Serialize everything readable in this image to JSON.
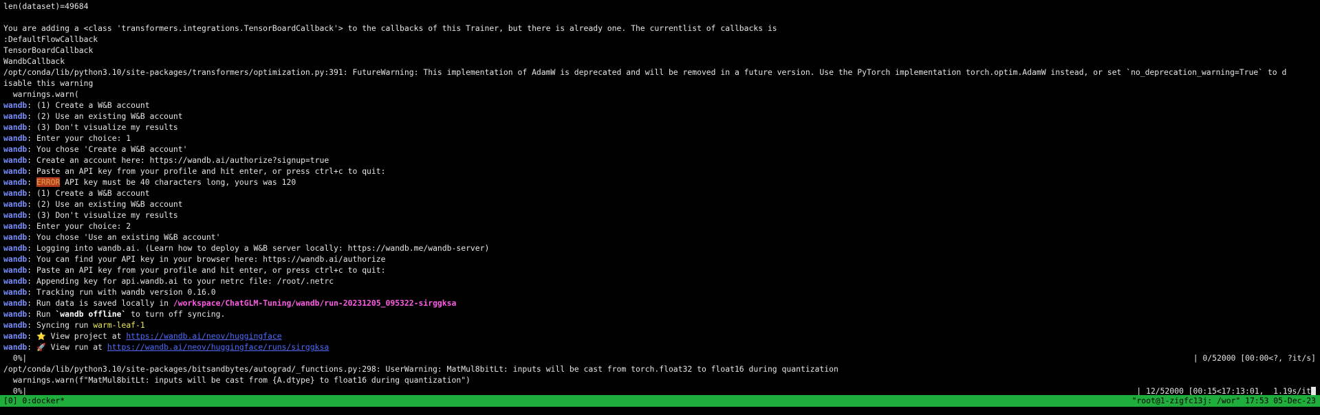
{
  "lines": {
    "l01": "len(dataset)=49684",
    "l02": "",
    "l03": "You are adding a <class 'transformers.integrations.TensorBoardCallback'> to the callbacks of this Trainer, but there is already one. The currentlist of callbacks is",
    "l04": ":DefaultFlowCallback",
    "l05": "TensorBoardCallback",
    "l06": "WandbCallback",
    "l07": "/opt/conda/lib/python3.10/site-packages/transformers/optimization.py:391: FutureWarning: This implementation of AdamW is deprecated and will be removed in a future version. Use the PyTorch implementation torch.optim.AdamW instead, or set `no_deprecation_warning=True` to d",
    "l08": "isable this warning",
    "l09": "  warnings.warn(",
    "w_prefix": "wandb",
    "w01": ": (1) Create a W&B account",
    "w02": ": (2) Use an existing W&B account",
    "w03": ": (3) Don't visualize my results",
    "w04": ": Enter your choice: 1",
    "w05": ": You chose 'Create a W&B account'",
    "w06": ": Create an account here: https://wandb.ai/authorize?signup=true",
    "w07": ": Paste an API key from your profile and hit enter, or press ctrl+c to quit:",
    "w08_sep": ": ",
    "w08_error": "ERROR",
    "w08_rest": " API key must be 40 characters long, yours was 120",
    "w09": ": (1) Create a W&B account",
    "w10": ": (2) Use an existing W&B account",
    "w11": ": (3) Don't visualize my results",
    "w12": ": Enter your choice: 2",
    "w13": ": You chose 'Use an existing W&B account'",
    "w14": ": Logging into wandb.ai. (Learn how to deploy a W&B server locally: https://wandb.me/wandb-server)",
    "w15": ": You can find your API key in your browser here: https://wandb.ai/authorize",
    "w16": ": Paste an API key from your profile and hit enter, or press ctrl+c to quit:",
    "w17": ": Appending key for api.wandb.ai to your netrc file: /root/.netrc",
    "w18": ": Tracking run with wandb version 0.16.0",
    "w19_pre": ": Run data is saved locally in ",
    "w19_path": "/workspace/ChatGLM-Tuning/wandb/run-20231205_095322-sirggksa",
    "w20_pre": ": Run ",
    "w20_bold": "`wandb offline`",
    "w20_post": " to turn off syncing.",
    "w21_pre": ": Syncing run ",
    "w21_run": "warm-leaf-1",
    "w22_pre": ": ",
    "w22_emoji": "⭐️",
    "w22_text": " View project at ",
    "w22_link": "https://wandb.ai/neov/huggingface",
    "w23_pre": ": ",
    "w23_emoji": "🚀",
    "w23_text": " View run at ",
    "w23_link": "https://wandb.ai/neov/huggingface/runs/sirggksa",
    "p1_left": "  0%|",
    "p1_right": "| 0/52000 [00:00<?, ?it/s]",
    "l10": "/opt/conda/lib/python3.10/site-packages/bitsandbytes/autograd/_functions.py:298: UserWarning: MatMul8bitLt: inputs will be cast from torch.float32 to float16 during quantization",
    "l11": "  warnings.warn(f\"MatMul8bitLt: inputs will be cast from {A.dtype} to float16 during quantization\")",
    "p2_left": "  0%|",
    "p2_right": "| 12/52000 [00:15<17:13:01,  1.19s/it"
  },
  "status_bar": {
    "left": "[0] 0:docker*",
    "right": "\"root@1-zigfc13j: /wor\" 17:53 05-Dec-23"
  },
  "colors": {
    "background": "#000000",
    "text": "#e6e6e6",
    "wandb_prefix": "#7b8cff",
    "error_bg": "#b13a1f",
    "path": "#ff5ce6",
    "run_name": "#e9e95a",
    "link": "#4f6bff",
    "status_bar": "#1fae3c"
  }
}
